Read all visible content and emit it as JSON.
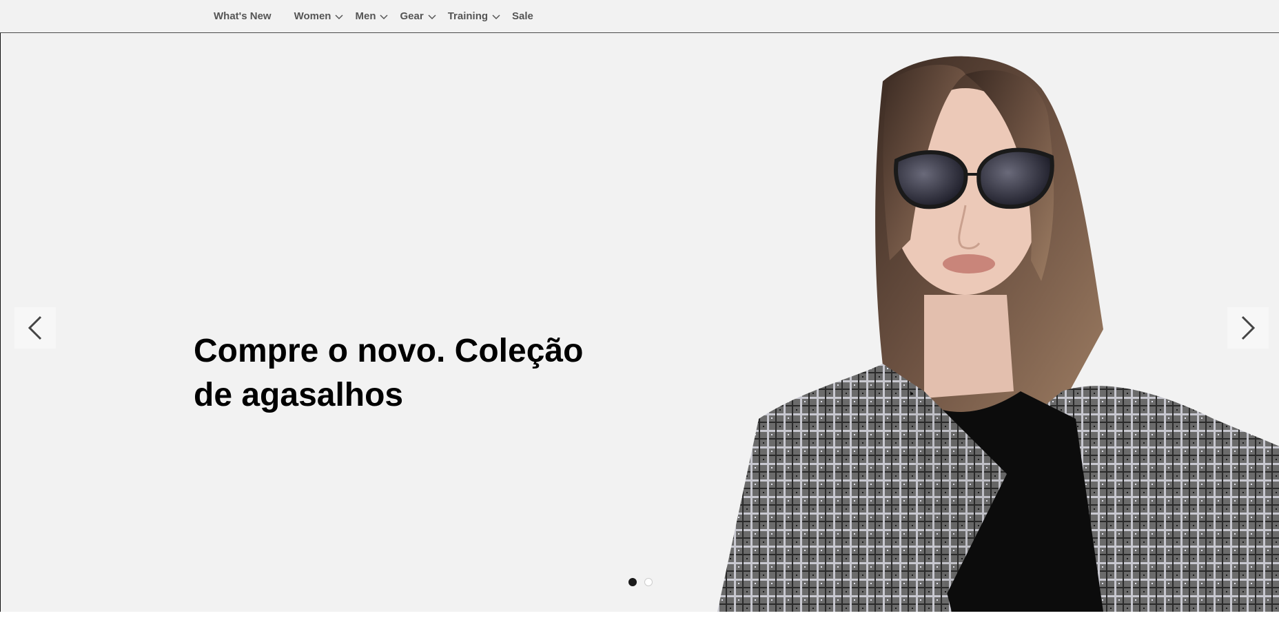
{
  "nav": {
    "items": [
      {
        "label": "What's New",
        "has_submenu": false
      },
      {
        "label": "Women",
        "has_submenu": true
      },
      {
        "label": "Men",
        "has_submenu": true
      },
      {
        "label": "Gear",
        "has_submenu": true
      },
      {
        "label": "Training",
        "has_submenu": true
      },
      {
        "label": "Sale",
        "has_submenu": false
      }
    ]
  },
  "hero": {
    "headline_line1": "Compre o novo. Coleção",
    "headline_line2": "de agasalhos",
    "prev_icon": "chevron-left-icon",
    "next_icon": "chevron-right-icon",
    "slides_total": 2,
    "active_slide": 1,
    "image_subject": "woman-in-sunglasses-and-plaid-coat"
  },
  "colors": {
    "background": "#f2f2f2",
    "text": "#000000",
    "nav_text": "#555555",
    "dot_active": "#1a1a1a"
  }
}
